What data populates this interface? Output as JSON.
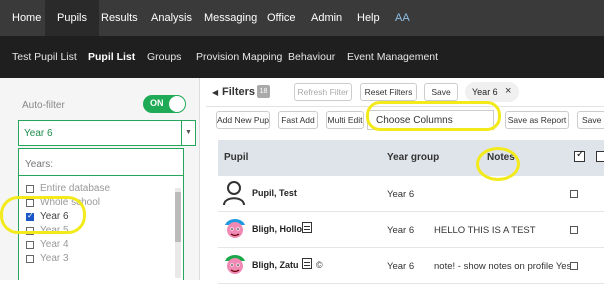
{
  "topnav": {
    "items": [
      "Home",
      "Pupils",
      "Results",
      "Analysis",
      "Messaging",
      "Office",
      "Admin",
      "Help",
      "AA"
    ]
  },
  "subnav": {
    "items": [
      "Test Pupil List",
      "Pupil List",
      "Groups",
      "Provision Mapping",
      "Behaviour",
      "Event Management"
    ]
  },
  "sidebar": {
    "autofilter_label": "Auto-filter",
    "toggle_label": "ON",
    "year_select_value": "Year 6",
    "years_header": "Years:",
    "options": [
      {
        "label": "Entire database",
        "checked": false
      },
      {
        "label": "Whole school",
        "checked": false
      },
      {
        "label": "Year 6",
        "checked": true
      },
      {
        "label": "Year 5",
        "checked": false
      },
      {
        "label": "Year 4",
        "checked": false
      },
      {
        "label": "Year 3",
        "checked": false
      }
    ]
  },
  "filters": {
    "title": "Filters",
    "count": "18",
    "refresh_label": "Refresh Filter",
    "reset_label": "Reset Filters",
    "save_label": "Save",
    "active_tag": "Year 6",
    "tag_close": "×"
  },
  "toolbar": {
    "add_new_pupil": "Add New Pupil",
    "fast_add": "Fast Add",
    "multi_edit": "Multi Edit",
    "choose_columns": "Choose Columns",
    "save_as_report": "Save as Report",
    "save_as": "Save as"
  },
  "table": {
    "headers": {
      "pupil": "Pupil",
      "year_group": "Year group",
      "notes": "Notes"
    },
    "rows": [
      {
        "name": "Pupil, Test",
        "year": "Year 6",
        "note": ""
      },
      {
        "name": "Bligh, Hollo",
        "year": "Year 6",
        "note": "HELLO THIS IS A TEST"
      },
      {
        "name": "Bligh, Zatu",
        "year": "Year 6",
        "note": "note! - show notes on profile Yes",
        "symbol": "©"
      }
    ]
  },
  "colors": {
    "accent_green": "#26a65b",
    "highlight_yellow": "#f3ea1c",
    "nav_dark": "#3a3a3a"
  }
}
